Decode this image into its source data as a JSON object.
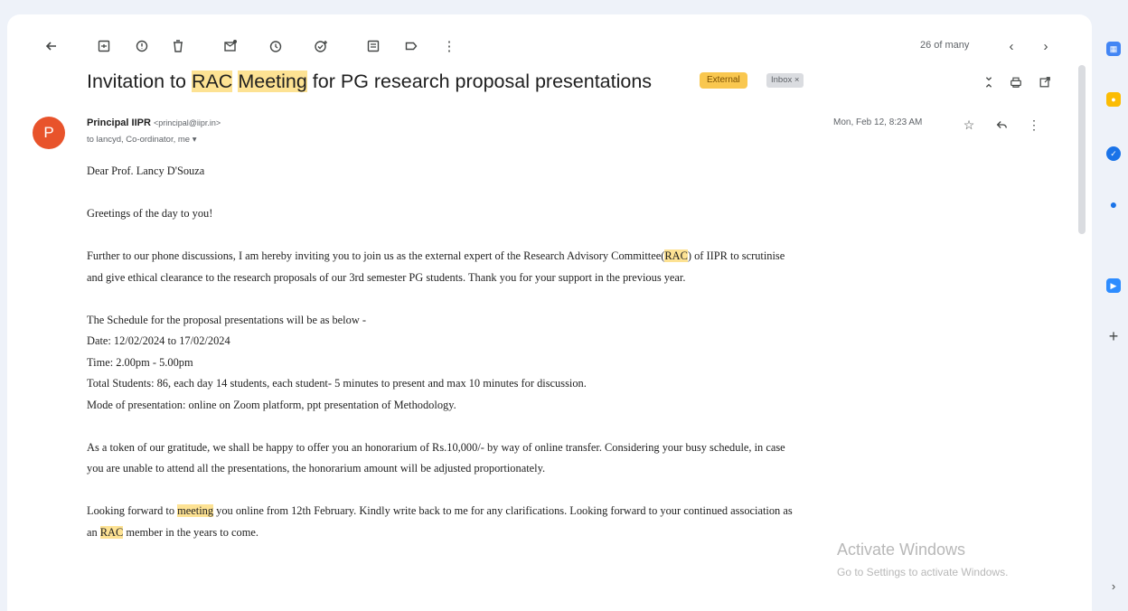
{
  "toolbar": {
    "pager_text": "26 of many",
    "icons": [
      "back-icon",
      "archive-icon",
      "report-spam-icon",
      "delete-icon",
      "mark-unread-icon",
      "snooze-icon",
      "add-task-icon",
      "move-to-icon",
      "label-icon",
      "more-vert-icon",
      "prev-icon",
      "next-icon"
    ]
  },
  "subject": {
    "part1": "Invitation to ",
    "hl1": "RAC",
    "space": " ",
    "hl2": "Meeting",
    "part2": " for PG research proposal presentations",
    "badge_external": "External",
    "badge_inbox": "Inbox ×"
  },
  "sender": {
    "avatar_letter": "P",
    "name": "Principal IIPR",
    "email": "<principal@iipr.in>",
    "recipients": "to lancyd, Co-ordinator, me ▾",
    "date": "Mon, Feb 12, 8:23 AM"
  },
  "body": {
    "salutation": "Dear Prof. Lancy D'Souza",
    "greeting": "Greetings of the day to you!",
    "para1_a": "Further to our phone discussions, I am hereby inviting you to join us as the external expert of the Research Advisory Committee(",
    "para1_hl": "RAC",
    "para1_b": ") of IIPR to scrutinise",
    "para1_line2": "and give ethical clearance to the research proposals of our 3rd semester PG students. Thank you for your support in the previous year.",
    "schedule_intro": "The Schedule for the proposal presentations will be as below -",
    "date_line": "Date: 12/02/2024 to 17/02/2024",
    "time_line": "Time: 2.00pm - 5.00pm",
    "students_line": "Total Students: 86, each day 14 students, each student- 5 minutes to present and max 10 minutes for discussion.",
    "mode_line": "Mode of presentation: online on Zoom platform, ppt presentation of Methodology.",
    "para3_line1": "As a token of our gratitude, we shall be happy to offer you an honorarium of Rs.10,000/- by way of online transfer. Considering your busy schedule, in case",
    "para3_line2": "you are unable to attend all the presentations, the honorarium amount will be adjusted proportionately.",
    "para4_a": "Looking forward to ",
    "para4_hl1": "meeting",
    "para4_b": " you online from 12th February. Kindly write back to me for any clarifications. Looking forward to your continued association as",
    "para4_c": "an ",
    "para4_hl2": "RAC",
    "para4_d": " member in the years to come."
  },
  "watermark": {
    "line1": "Activate Windows",
    "line2": "Go to Settings to activate Windows."
  },
  "colors": {
    "highlight": "#fde293",
    "avatar": "#e8532b",
    "external_badge": "#f9c74f"
  }
}
